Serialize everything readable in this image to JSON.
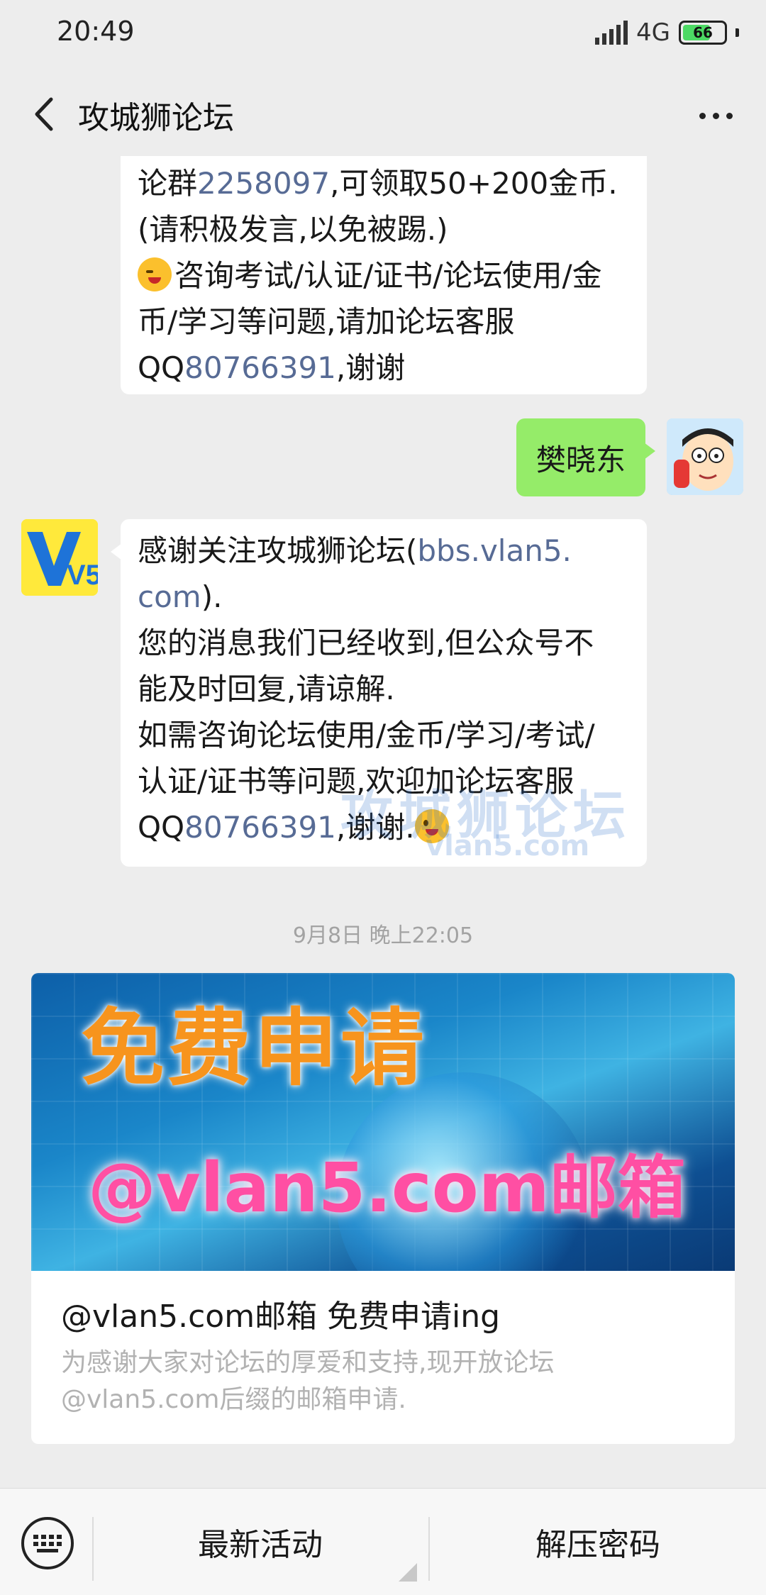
{
  "status_bar": {
    "time": "20:49",
    "network": "4G",
    "battery": "66"
  },
  "nav": {
    "title": "攻城狮论坛"
  },
  "messages": {
    "first_bubble": {
      "line1_prefix": "论群",
      "line1_link": "2258097",
      "line1_suffix": ",可领取50+200金币.",
      "line2": "(请积极发言,以免被踢.)",
      "line3": "咨询考试/认证/证书/论坛使用/金",
      "line4": "币/学习等问题,请加论坛客服",
      "line5_prefix": "QQ",
      "line5_link": "80766391",
      "line5_suffix": ",谢谢"
    },
    "user_bubble": {
      "text": "樊晓东"
    },
    "reply_bubble": {
      "line1_prefix": "感谢关注攻城狮论坛(",
      "line1_link": "bbs.vlan5.",
      "line2_link": "com",
      "line2_suffix": ").",
      "line3": "您的消息我们已经收到,但公众号不",
      "line4": "能及时回复,请谅解.",
      "line5": "如需咨询论坛使用/金币/学习/考试/",
      "line6": "认证/证书等问题,欢迎加论坛客服",
      "line7_prefix": "QQ",
      "line7_link": "80766391",
      "line7_suffix": ",谢谢."
    },
    "bot_avatar_text": "V5",
    "watermark": {
      "title": "攻城狮论坛",
      "sub": "vlan5.com"
    }
  },
  "timestamp": "9月8日 晚上22:05",
  "article": {
    "banner_title": "免费申请",
    "banner_sub": "@vlan5.com邮箱",
    "title": "@vlan5.com邮箱  免费申请ing",
    "desc_line1": "为感谢大家对论坛的厚爱和支持,现开放论坛",
    "desc_line2": "@vlan5.com后缀的邮箱申请."
  },
  "bottom_menu": {
    "item1": "最新活动",
    "item2": "解压密码"
  },
  "colors": {
    "link": "#576b95",
    "green_bubble": "#95ec69",
    "background": "#ededed"
  },
  "icons": [
    "back-arrow-icon",
    "more-icon",
    "keyboard-icon",
    "signal-icon",
    "battery-icon"
  ]
}
